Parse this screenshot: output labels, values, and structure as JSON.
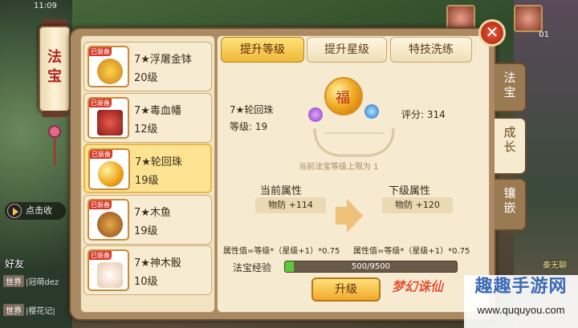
{
  "status": {
    "time": "11:09"
  },
  "hud": {
    "level_badge": "01",
    "friend_label": "好友",
    "voice_label": "点击收",
    "side_name": "秦无聊"
  },
  "chat": [
    {
      "channel": "世界",
      "text": "|冠萌dez"
    },
    {
      "channel": "世界",
      "text": "|樱花记|"
    }
  ],
  "lantern": {
    "line1": "法",
    "line2": "宝"
  },
  "list": [
    {
      "tag": "已装备",
      "name": "7★浮屠金钵",
      "level": "20级"
    },
    {
      "tag": "已装备",
      "name": "7★毒血幡",
      "level": "12级"
    },
    {
      "tag": "已装备",
      "name": "7★轮回珠",
      "level": "19级"
    },
    {
      "tag": "已装备",
      "name": "7★木鱼",
      "level": "19级"
    },
    {
      "tag": "已装备",
      "name": "7★神木骰",
      "level": "10级"
    }
  ],
  "tabs": [
    {
      "label": "提升等级"
    },
    {
      "label": "提升星级"
    },
    {
      "label": "特技洗练"
    }
  ],
  "side_tabs": [
    {
      "label": "法宝"
    },
    {
      "label": "成长"
    },
    {
      "label": "镶嵌"
    }
  ],
  "detail": {
    "name": "7★轮回珠",
    "level_label": "等级:",
    "level_value": "19",
    "score_label": "评分:",
    "score_value": "314",
    "limit_note": "当前法宝等级上限为 1",
    "current_attr_title": "当前属性",
    "next_attr_title": "下级属性",
    "current_attr_value": "物防 +114",
    "next_attr_value": "物防 +120",
    "formula_left": "属性值=等级*（星级+1）*0.75",
    "formula_right": "属性值=等级*（星级+1）*0.75",
    "exp_label": "法宝经验",
    "exp_text": "500/9500",
    "exp_fraction": 0.0526,
    "upgrade_label": "升级"
  },
  "close_glyph": "✕",
  "watermark": {
    "logo": "梦幻诛仙",
    "title": "趣趣手游网",
    "url": "www.ququyou.com"
  },
  "colors": {
    "accent": "#f0b83a",
    "exp_fill": "#5ac83a",
    "equip_tag": "#d83a2a"
  }
}
